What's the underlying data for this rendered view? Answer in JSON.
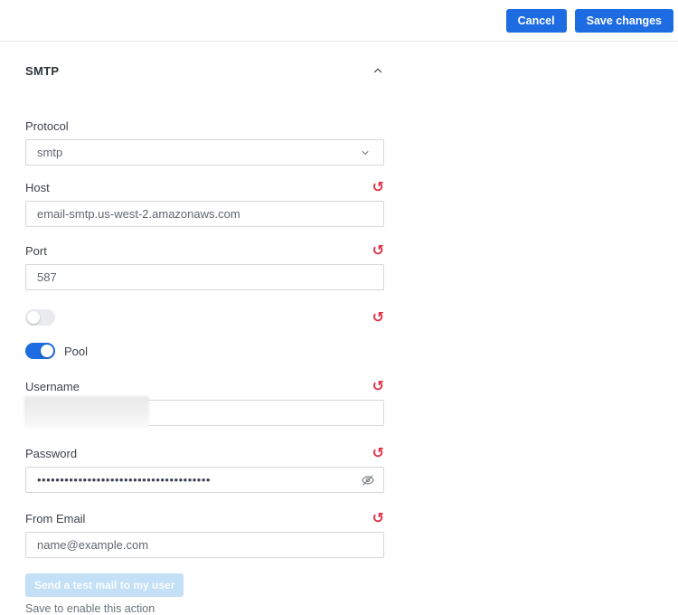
{
  "colors": {
    "accent": "#1d6ce2",
    "danger": "#e02f44",
    "disabled_button_bg": "#c3e0f7"
  },
  "toolbar": {
    "cancel_label": "Cancel",
    "save_label": "Save changes"
  },
  "section": {
    "title": "SMTP",
    "protocol": {
      "label": "Protocol",
      "value": "smtp"
    },
    "host": {
      "label": "Host",
      "value": "email-smtp.us-west-2.amazonaws.com"
    },
    "port": {
      "label": "Port",
      "value": "587"
    },
    "unnamed_toggle": {
      "state": "off"
    },
    "pool_toggle": {
      "label": "Pool",
      "state": "on"
    },
    "username": {
      "label": "Username",
      "value": ""
    },
    "password": {
      "label": "Password",
      "masked_value": "••••••••••••••••••••••••••••••••••••••"
    },
    "from_email": {
      "label": "From Email",
      "value": "name@example.com"
    },
    "test_button_label": "Send a test mail to my user",
    "test_hint": "Save to enable this action"
  }
}
